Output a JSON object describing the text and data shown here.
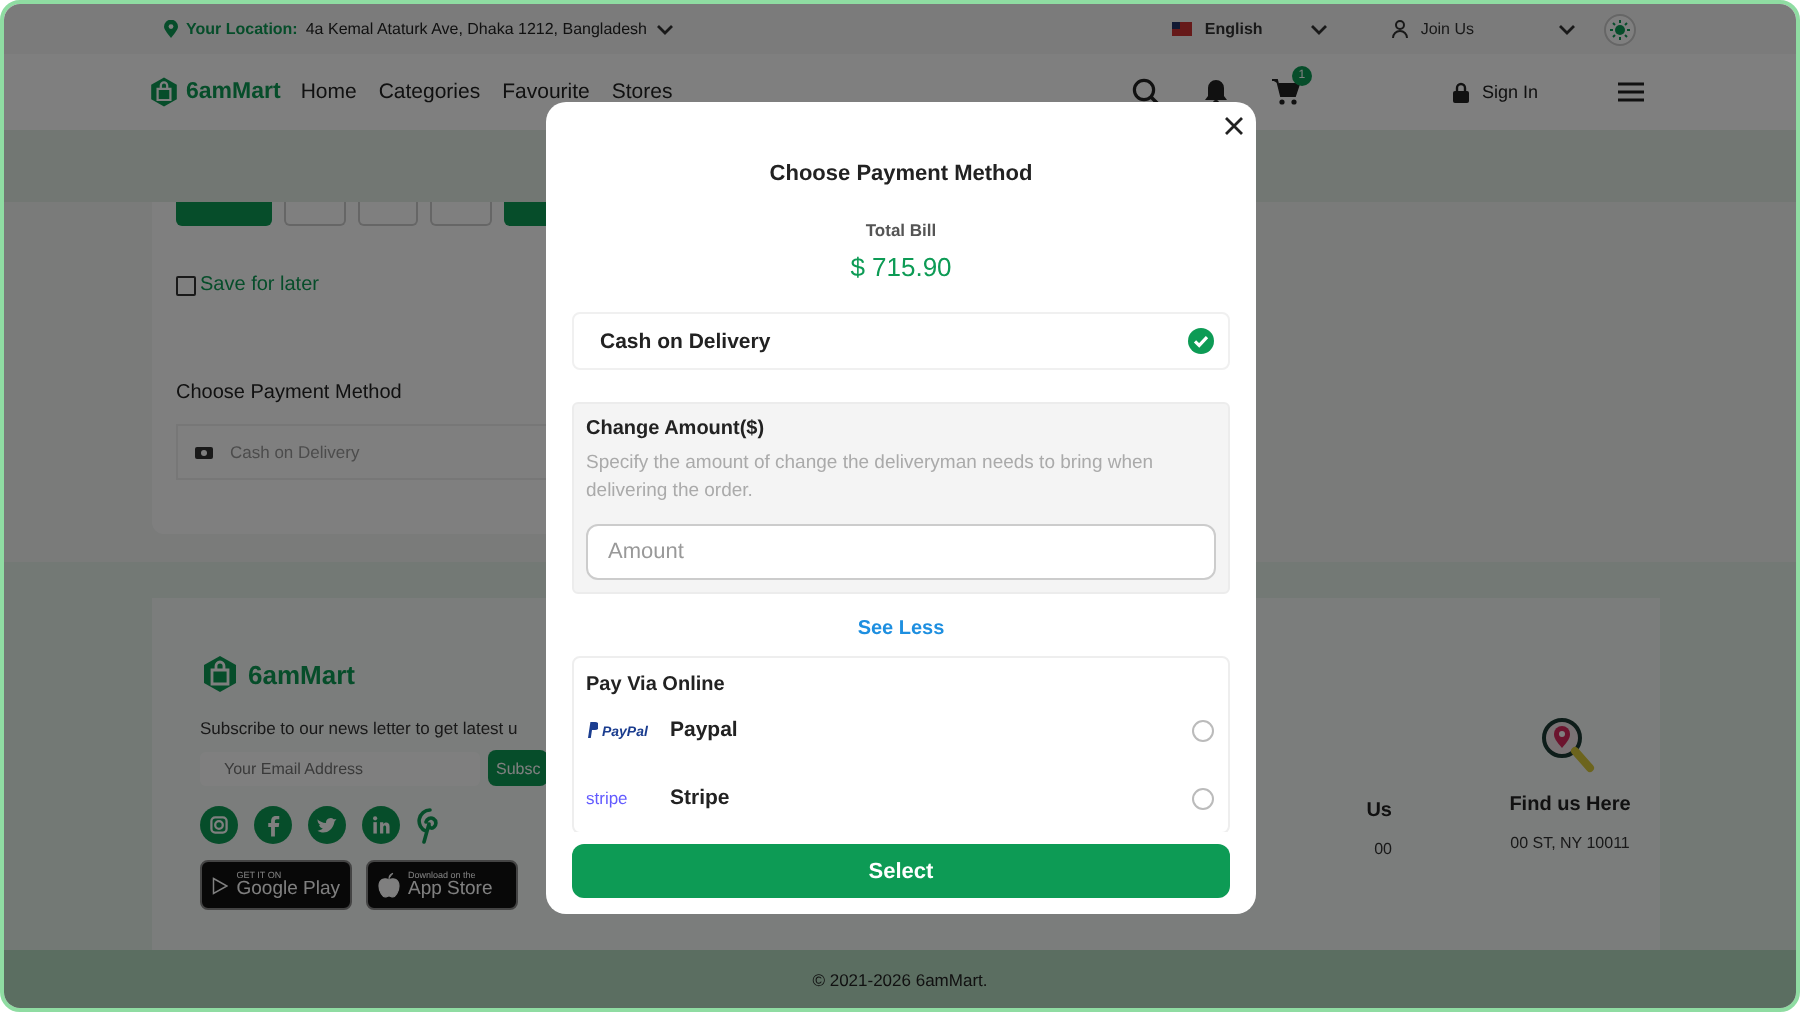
{
  "top_bar": {
    "location_label": "Your Location:",
    "location": "4a Kemal Ataturk Ave, Dhaka 1212, Bangladesh",
    "language": "English",
    "account": "Join Us"
  },
  "nav": {
    "brand": "6amMart",
    "links": [
      "Home",
      "Categories",
      "Favourite",
      "Stores"
    ],
    "cart_count": "1",
    "sign_in": "Sign In"
  },
  "checkout": {
    "steps": [
      {
        "selected": true
      },
      {
        "selected": false
      },
      {
        "selected": false
      },
      {
        "selected": false
      },
      {
        "selected": true
      }
    ],
    "save_for_later": {
      "label": "Save for later",
      "checked": false
    },
    "payment_heading": "Choose Payment Method",
    "payment_value": "Cash on Delivery"
  },
  "footer": {
    "brand": "6amMart",
    "subscribe_text": "Subscribe to our news letter to get latest u",
    "email_placeholder": "Your Email Address",
    "subscribe_button": "Subsc",
    "stores": [
      {
        "kind": "google",
        "small": "GET IT ON",
        "label": "Google Play"
      },
      {
        "kind": "apple",
        "small": "Download on the",
        "label": "App Store"
      }
    ],
    "contacts": [
      {
        "kind": "cut",
        "title": "Us",
        "detail": "00"
      },
      {
        "kind": "map",
        "title": "Find us Here",
        "detail": "00 ST, NY 10011"
      }
    ],
    "copyright": "© 2021-2026 6amMart."
  },
  "modal": {
    "title": "Choose Payment Method",
    "total_label": "Total Bill",
    "total": "$ 715.90",
    "cod": {
      "label": "Cash on Delivery",
      "selected": true
    },
    "change": {
      "title": "Change Amount($)",
      "description": "Specify the amount of change the deliveryman needs to bring when delivering the order.",
      "placeholder": "Amount"
    },
    "toggle": "See Less",
    "online": {
      "title": "Pay Via Online",
      "methods": [
        {
          "kind": "paypal",
          "logo": "PayPal",
          "name": "Paypal",
          "selected": false
        },
        {
          "kind": "stripe",
          "logo": "stripe",
          "name": "Stripe",
          "selected": false
        }
      ]
    },
    "button": "Select"
  }
}
